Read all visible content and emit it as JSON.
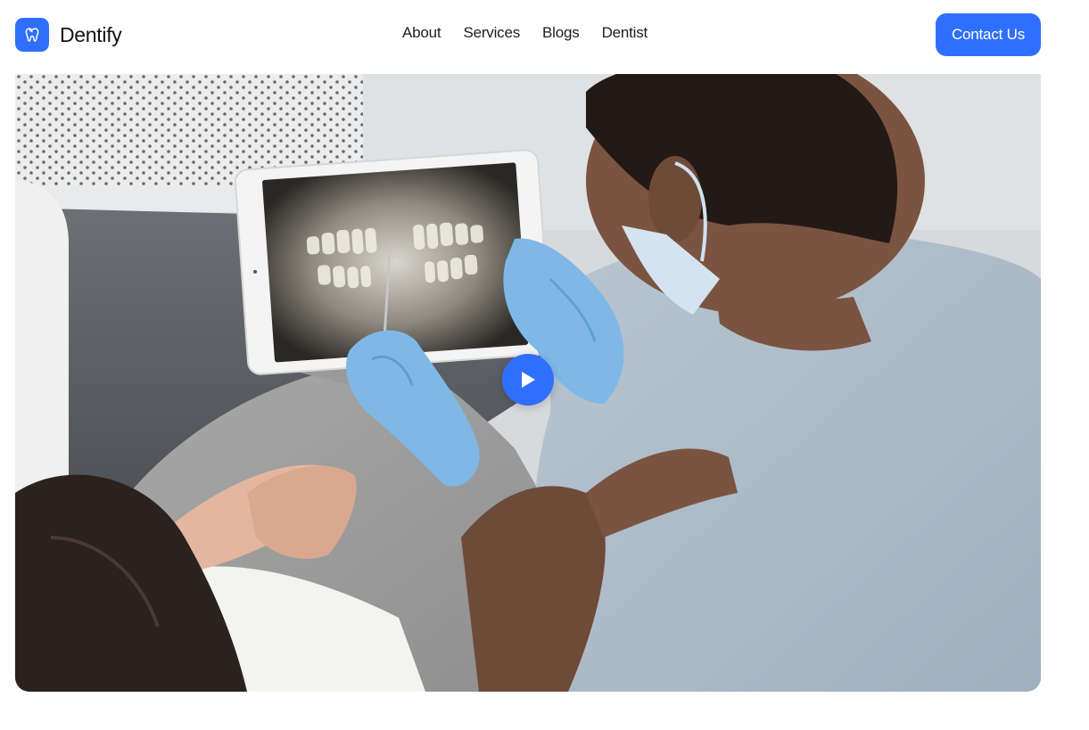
{
  "brand": {
    "name": "Dentify",
    "logo_icon": "tooth-icon",
    "accent_color": "#2f6fff"
  },
  "nav": {
    "links": [
      {
        "label": "About"
      },
      {
        "label": "Services"
      },
      {
        "label": "Blogs"
      },
      {
        "label": "Dentist"
      }
    ],
    "cta_label": "Contact Us"
  },
  "hero": {
    "media_type": "video",
    "play_icon": "play-icon"
  }
}
